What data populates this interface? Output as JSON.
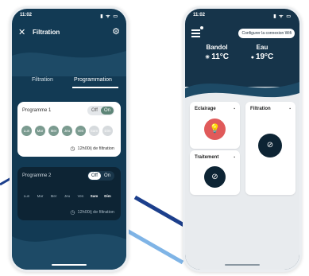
{
  "left_phone": {
    "status_time": "11:02",
    "status_icons": "▮ ᯤ ▭",
    "title": "Filtration",
    "tabs": [
      "Filtration",
      "Programmation"
    ],
    "programmes": [
      {
        "name": "Programme 1",
        "off": "Off",
        "on": "On",
        "days": [
          "Lun",
          "Mar",
          "Mer",
          "Jeu",
          "Ven",
          "Sam",
          "Dim"
        ],
        "filtration": "12h00/j de filtration"
      },
      {
        "name": "Programme 2",
        "off": "Off",
        "on": "On",
        "days": [
          "Lun",
          "Mar",
          "Mer",
          "Jeu",
          "Ven",
          "Sam",
          "Dim"
        ],
        "filtration": "12h00/j de filtration"
      }
    ]
  },
  "right_phone": {
    "status_time": "11:02",
    "status_icons": "▮ ᯤ ▭",
    "wifi_button": "Configurer la connexion Wifi",
    "weather": [
      {
        "location": "Bandol",
        "temp": "11°C",
        "icon": "sun-icon"
      },
      {
        "location": "Eau",
        "temp": "19°C",
        "icon": "water-drop-icon"
      }
    ],
    "tiles": [
      "Eclairage",
      "Filtration",
      "Traitement"
    ]
  },
  "colors": {
    "dark_blue": "#123a54",
    "accent_green": "#5d8577",
    "light_red": "#e05a5a"
  }
}
